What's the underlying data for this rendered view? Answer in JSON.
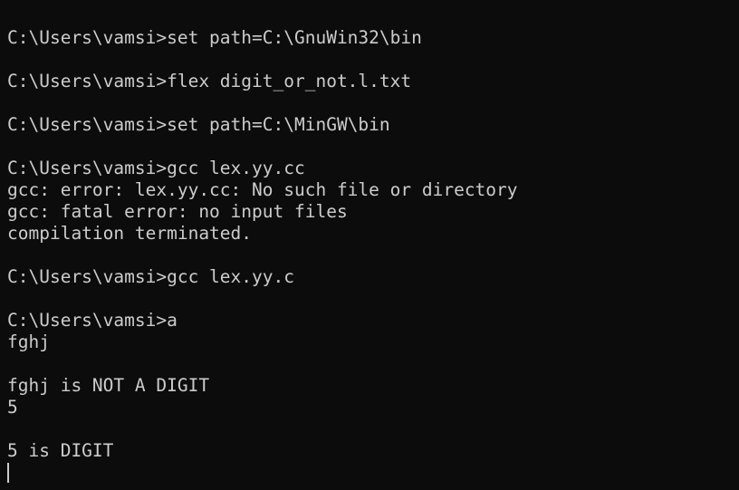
{
  "terminal": {
    "lines": [
      "C:\\Users\\vamsi>set path=C:\\GnuWin32\\bin",
      "",
      "C:\\Users\\vamsi>flex digit_or_not.l.txt",
      "",
      "C:\\Users\\vamsi>set path=C:\\MinGW\\bin",
      "",
      "C:\\Users\\vamsi>gcc lex.yy.cc",
      "gcc: error: lex.yy.cc: No such file or directory",
      "gcc: fatal error: no input files",
      "compilation terminated.",
      "",
      "C:\\Users\\vamsi>gcc lex.yy.c",
      "",
      "C:\\Users\\vamsi>a",
      "fghj",
      "",
      "fghj is NOT A DIGIT",
      "5",
      "",
      "5 is DIGIT",
      ""
    ]
  }
}
